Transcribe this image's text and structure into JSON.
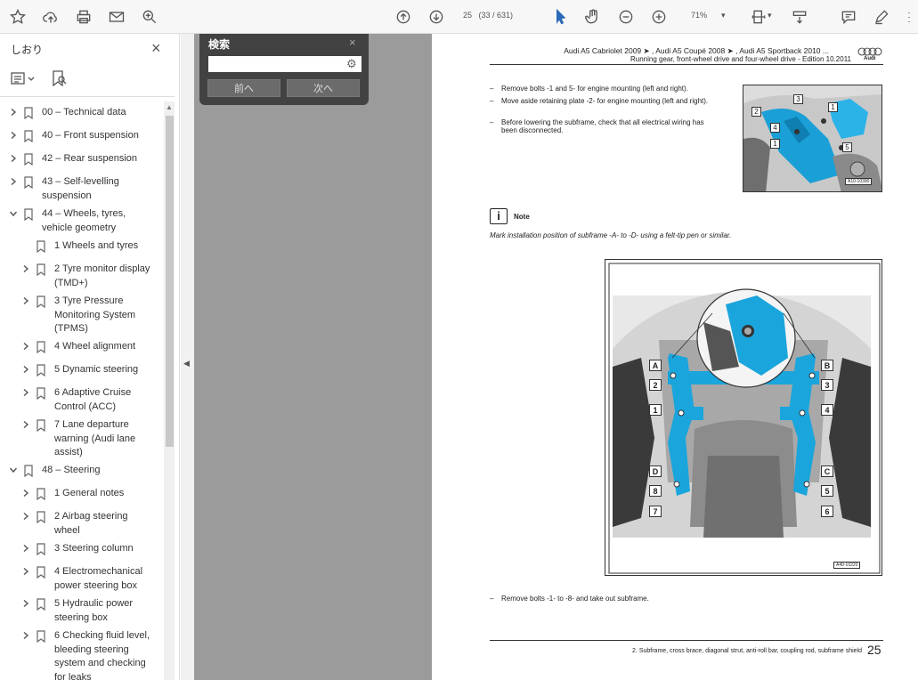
{
  "toolbar": {
    "page_current": "25",
    "page_total": "(33 / 631)",
    "zoom": "71%",
    "icons": [
      "star-icon",
      "cloud-upload-icon",
      "print-icon",
      "mail-icon",
      "zoom-search-icon",
      "page-up-icon",
      "page-down-icon",
      "select-cursor-icon",
      "hand-icon",
      "zoom-out-icon",
      "zoom-in-icon",
      "fit-page-icon",
      "scroll-mode-icon",
      "comment-icon",
      "pen-icon"
    ]
  },
  "sidebar": {
    "title": "しおり",
    "close": "×",
    "bookmarks": [
      {
        "label": "00 – Technical data",
        "level": 0,
        "expanded": false
      },
      {
        "label": "40 – Front suspension",
        "level": 0,
        "expanded": false
      },
      {
        "label": "42 – Rear suspension",
        "level": 0,
        "expanded": false
      },
      {
        "label": "43 – Self-levelling suspension",
        "level": 0,
        "expanded": false
      },
      {
        "label": "44 – Wheels, tyres, vehicle geometry",
        "level": 0,
        "expanded": true
      },
      {
        "label": "1 Wheels and tyres",
        "level": 1,
        "expanded": null
      },
      {
        "label": "2 Tyre monitor display (TMD+)",
        "level": 1,
        "expanded": false
      },
      {
        "label": "3 Tyre Pressure Monitoring System (TPMS)",
        "level": 1,
        "expanded": false
      },
      {
        "label": "4 Wheel alignment",
        "level": 1,
        "expanded": false
      },
      {
        "label": "5 Dynamic steering",
        "level": 1,
        "expanded": false
      },
      {
        "label": "6 Adaptive Cruise Control (ACC)",
        "level": 1,
        "expanded": false
      },
      {
        "label": "7 Lane departure warning (Audi lane assist)",
        "level": 1,
        "expanded": false
      },
      {
        "label": "48 – Steering",
        "level": 0,
        "expanded": true
      },
      {
        "label": "1 General notes",
        "level": 1,
        "expanded": false
      },
      {
        "label": "2 Airbag steering wheel",
        "level": 1,
        "expanded": false
      },
      {
        "label": "3 Steering column",
        "level": 1,
        "expanded": false
      },
      {
        "label": "4 Electromechanical power steering box",
        "level": 1,
        "expanded": false
      },
      {
        "label": "5 Hydraulic power steering box",
        "level": 1,
        "expanded": false
      },
      {
        "label": "6 Checking fluid level, bleeding steering system and checking for leaks",
        "level": 1,
        "expanded": false
      }
    ]
  },
  "search": {
    "title": "検索",
    "close": "×",
    "placeholder": "",
    "prev_label": "前へ",
    "next_label": "次へ"
  },
  "page": {
    "header_line1": "Audi A5 Cabriolet 2009 ➤ , Audi A5 Coupé 2008 ➤ , Audi A5 Sportback 2010 ...",
    "header_line2": "Running gear, front-wheel drive and four-wheel drive - Edition 10.2011",
    "brand": "Audi",
    "steps": [
      "Remove bolts -1 and 5- for engine mounting (left and right).",
      "Move aside retaining plate -2- for engine mounting (left and right).",
      "Before lowering the subframe, check that all electrical wiring has been disconnected."
    ],
    "note_label": "Note",
    "note_text": "Mark installation position of subframe -A- to -D- using a felt-tip pen or similar.",
    "last_step": "Remove bolts -1- to -8- and take out subframe.",
    "footer": "2. Subframe, cross brace, diagonal strut, anti-roll bar, coupling rod, subframe shield",
    "page_number": "25",
    "fig1_code": "A10-10390",
    "fig2_code": "A40-10220",
    "fig1_callouts": [
      "3",
      "2",
      "4",
      "1",
      "5"
    ],
    "fig2_callouts_left": [
      "A",
      "2",
      "1",
      "D",
      "8",
      "7"
    ],
    "fig2_callouts_right": [
      "B",
      "3",
      "4",
      "C",
      "5",
      "6"
    ]
  }
}
